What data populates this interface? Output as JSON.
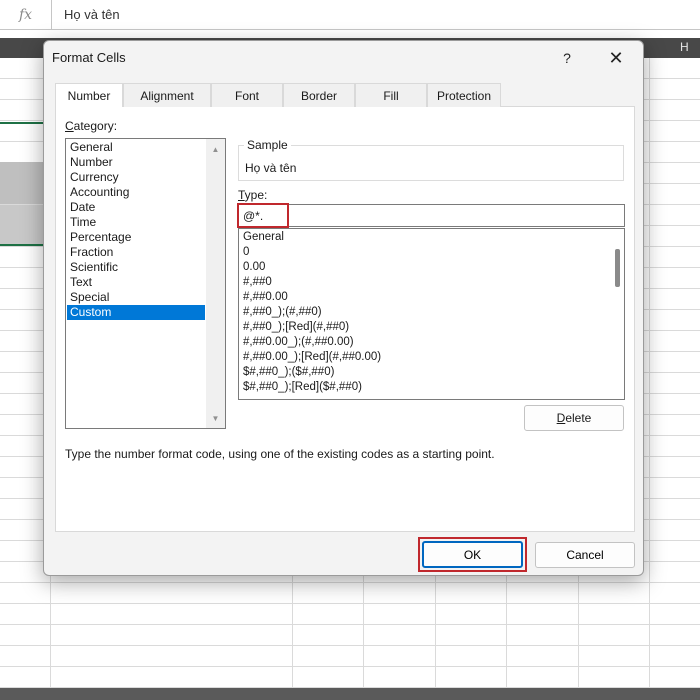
{
  "excel": {
    "formula_icon": "fx",
    "formula_value": "Họ và tên",
    "column_label": "H"
  },
  "dialog": {
    "title": "Format Cells",
    "help_label": "?",
    "close_label": "✕",
    "tabs": [
      {
        "label": "Number",
        "active": true
      },
      {
        "label": "Alignment",
        "active": false
      },
      {
        "label": "Font",
        "active": false
      },
      {
        "label": "Border",
        "active": false
      },
      {
        "label": "Fill",
        "active": false
      },
      {
        "label": "Protection",
        "active": false
      }
    ],
    "category": {
      "label_accel": "C",
      "label_rest": "ategory:",
      "items": [
        "General",
        "Number",
        "Currency",
        "Accounting",
        "Date",
        "Time",
        "Percentage",
        "Fraction",
        "Scientific",
        "Text",
        "Special",
        "Custom"
      ],
      "selected": "Custom"
    },
    "sample": {
      "label": "Sample",
      "value": "Họ và tên"
    },
    "type": {
      "label_accel": "T",
      "label_rest": "ype:",
      "value": "@*."
    },
    "formats": [
      "General",
      "0",
      "0.00",
      "#,##0",
      "#,##0.00",
      "#,##0_);(#,##0)",
      "#,##0_);[Red](#,##0)",
      "#,##0.00_);(#,##0.00)",
      "#,##0.00_);[Red](#,##0.00)",
      "$#,##0_);($#,##0)",
      "$#,##0_);[Red]($#,##0)"
    ],
    "delete_accel": "D",
    "delete_rest": "elete",
    "description": "Type the number format code, using one of the existing codes as a starting point.",
    "ok_label": "OK",
    "cancel_label": "Cancel"
  },
  "colors": {
    "selection": "#0078d7",
    "highlight": "#c0282d",
    "ok_border": "#0067c0"
  },
  "icons": [
    "fx-icon",
    "help-icon",
    "close-icon",
    "scroll-up-icon",
    "scroll-down-icon"
  ]
}
